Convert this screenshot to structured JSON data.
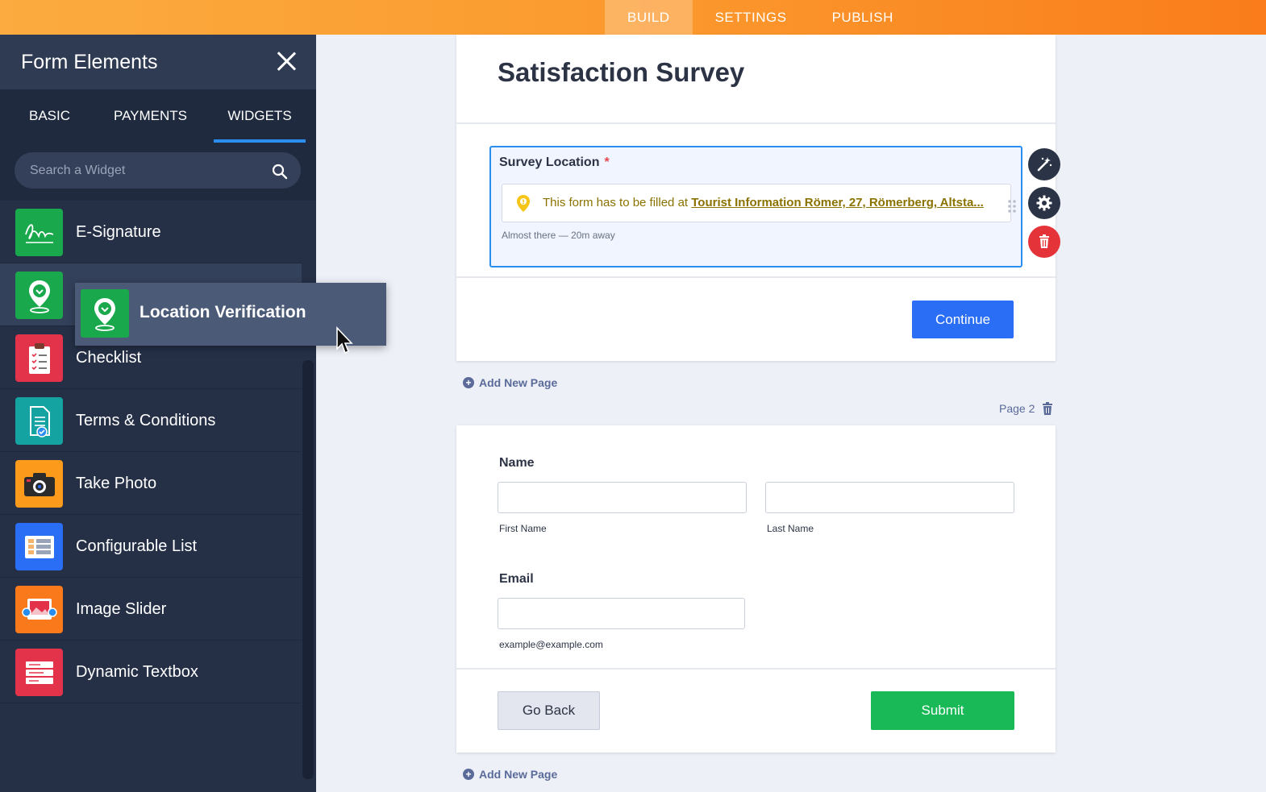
{
  "topnav": {
    "tabs": [
      "BUILD",
      "SETTINGS",
      "PUBLISH"
    ],
    "active": "BUILD"
  },
  "sidebar": {
    "title": "Form Elements",
    "tabs": [
      "BASIC",
      "PAYMENTS",
      "WIDGETS"
    ],
    "active_tab": "WIDGETS",
    "search_placeholder": "Search a Widget",
    "items": [
      {
        "label": "E-Signature",
        "icon": "signature-icon",
        "color": "#1aa84d"
      },
      {
        "label": "",
        "icon": "location-pin-icon",
        "color": "#1aa84d"
      },
      {
        "label": "Checklist",
        "icon": "checklist-icon",
        "color": "#e2334b"
      },
      {
        "label": "Terms & Conditions",
        "icon": "document-check-icon",
        "color": "#14a3a1"
      },
      {
        "label": "Take Photo",
        "icon": "camera-icon",
        "color": "#fb9a1b"
      },
      {
        "label": "Configurable List",
        "icon": "list-grid-icon",
        "color": "#2a6ef5"
      },
      {
        "label": "Image Slider",
        "icon": "image-slider-icon",
        "color": "#fa7a1b"
      },
      {
        "label": "Dynamic Textbox",
        "icon": "textbox-icon",
        "color": "#e2334b"
      }
    ]
  },
  "drag": {
    "label": "Location Verification",
    "icon": "location-pin-icon"
  },
  "form": {
    "title": "Satisfaction Survey",
    "location_field": {
      "label": "Survey Location",
      "required_mark": "*",
      "notice_prefix": "This form has to be filled at ",
      "notice_link": "Tourist Information Römer, 27, Römerberg, Altsta...",
      "subtext": "Almost there — 20m away"
    },
    "continue_label": "Continue",
    "add_page_label": "Add New Page",
    "page_indicator": "Page 2",
    "name_label": "Name",
    "first_name_sub": "First Name",
    "last_name_sub": "Last Name",
    "email_label": "Email",
    "email_sub": "example@example.com",
    "back_label": "Go Back",
    "submit_label": "Submit"
  },
  "colors": {
    "accent_blue": "#2a8ef0",
    "continue_blue": "#2a6ef5",
    "submit_green": "#18b956",
    "delete_red": "#e5333a",
    "topbar_orange": "#fb9a2e"
  }
}
